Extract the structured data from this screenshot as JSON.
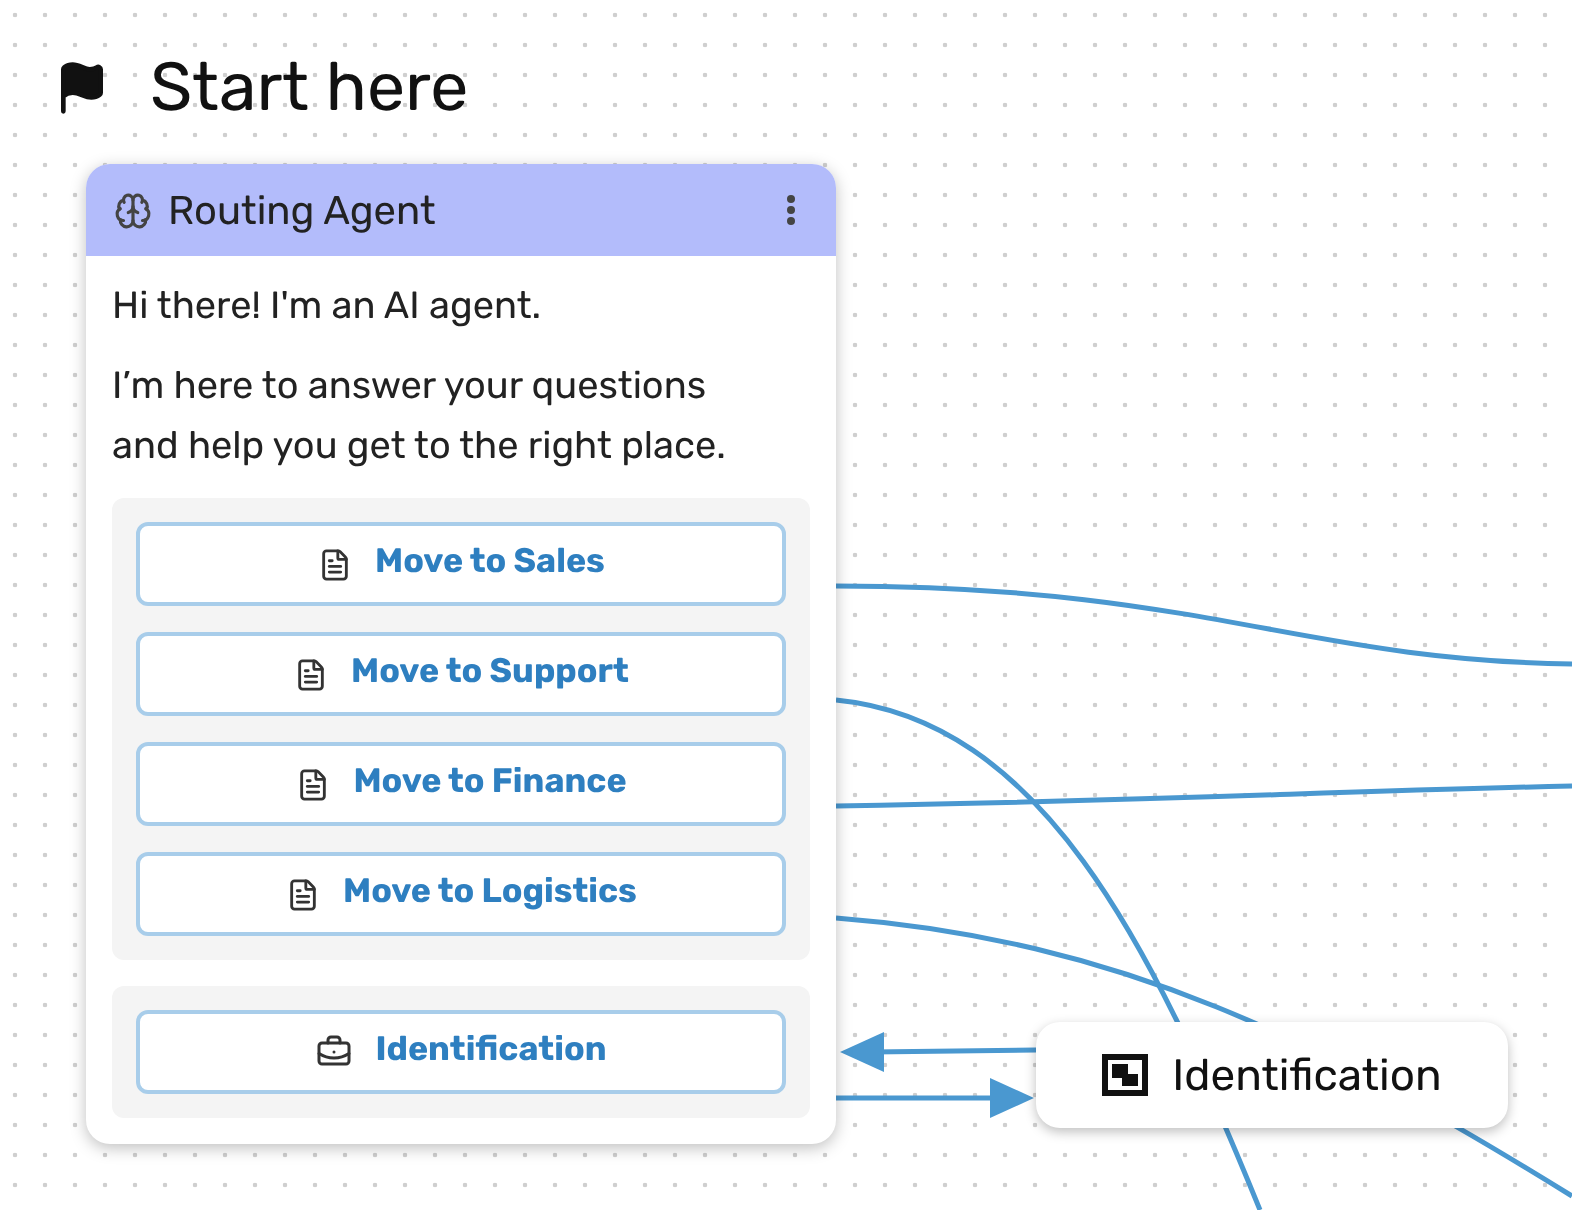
{
  "heading": "Start here",
  "agent": {
    "title": "Routing Agent",
    "greeting": "Hi there! I'm an AI agent.",
    "intro": "I’m here to answer your questions and help you get to the right place.",
    "actions": [
      {
        "label": "Move to Sales"
      },
      {
        "label": "Move to Support"
      },
      {
        "label": "Move to Finance"
      },
      {
        "label": "Move to Logistics"
      }
    ],
    "tools": [
      {
        "label": "Identification"
      }
    ]
  },
  "nodes": [
    {
      "label": "Identification"
    }
  ]
}
